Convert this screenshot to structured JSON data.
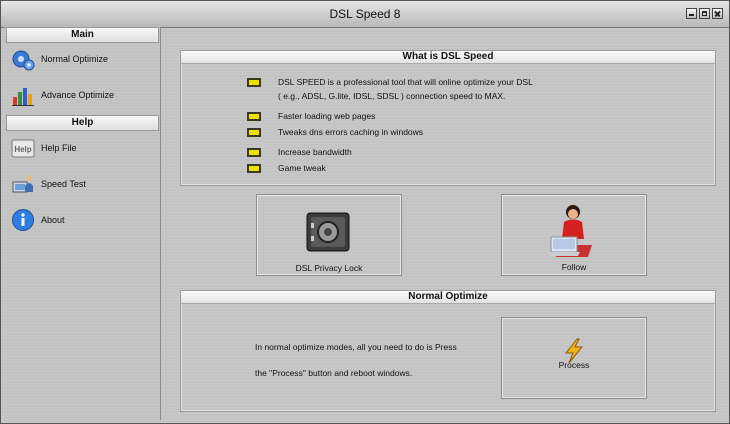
{
  "window": {
    "title": "DSL Speed 8"
  },
  "sidebar": {
    "main_header": "Main",
    "help_header": "Help",
    "items": [
      {
        "label": "Normal Optimize",
        "icon": "gears-icon"
      },
      {
        "label": "Advance Optimize",
        "icon": "bar-chart-icon"
      },
      {
        "label": "Help File",
        "icon": "help-book-icon"
      },
      {
        "label": "Speed Test",
        "icon": "computer-user-icon"
      },
      {
        "label": "About",
        "icon": "info-icon"
      }
    ]
  },
  "what_is": {
    "title": "What is DSL Speed",
    "intro_line1": "DSL SPEED is a professional tool that will online optimize your DSL",
    "intro_line2": "( e.g., ADSL, G.lite, IDSL, SDSL ) connection speed to MAX.",
    "features": [
      "Faster loading web pages",
      "Tweaks dns errors caching in windows",
      "Increase bandwidth",
      "Game tweak"
    ],
    "bullet_color": "#f2e100"
  },
  "actions": {
    "privacy_lock_label": "DSL Privacy Lock",
    "follow_label": "Follow"
  },
  "normal_optimize": {
    "title": "Normal Optimize",
    "desc_line1": "In normal optimize modes, all you need to do is Press",
    "desc_line2": "the \"Process\" button and reboot windows.",
    "process_label": "Process"
  }
}
